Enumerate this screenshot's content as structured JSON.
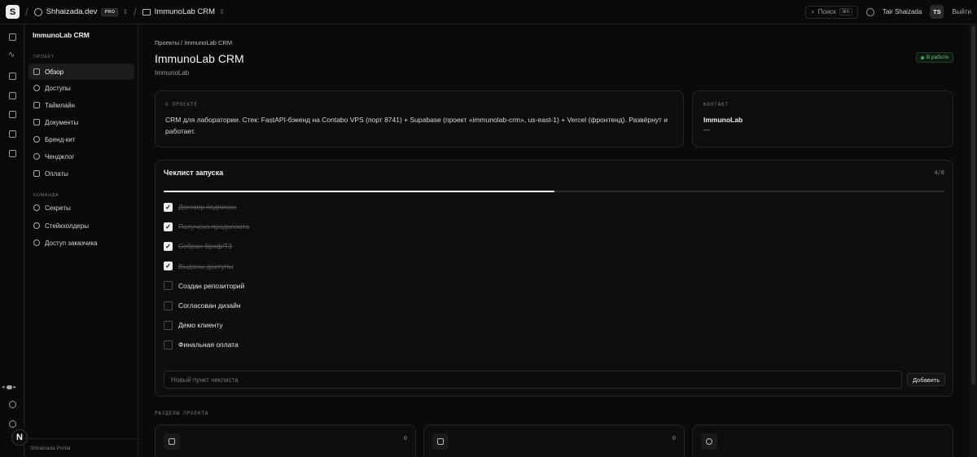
{
  "topbar": {
    "workspace": "Shhaizada.dev",
    "plan": "PRO",
    "project": "ImmunoLab CRM",
    "search_label": "Поиск",
    "search_kbd": "⌘K",
    "user_name": "Tair Shaizada",
    "user_initials": "TS",
    "logout": "Выйти"
  },
  "sidebar": {
    "title": "ImmunoLab CRM",
    "group_project": "Проект",
    "project_items": [
      {
        "label": "Обзор",
        "icon": "layout-icon",
        "active": true
      },
      {
        "label": "Доступы",
        "icon": "key-icon"
      },
      {
        "label": "Таймлайн",
        "icon": "calendar-icon"
      },
      {
        "label": "Документы",
        "icon": "file-icon"
      },
      {
        "label": "Бренд-кит",
        "icon": "palette-icon"
      },
      {
        "label": "Ченджлог",
        "icon": "history-icon"
      },
      {
        "label": "Оплаты",
        "icon": "card-icon"
      }
    ],
    "group_team": "Команда",
    "team_items": [
      {
        "label": "Секреты",
        "icon": "key-icon"
      },
      {
        "label": "Стейкхолдеры",
        "icon": "user-icon"
      },
      {
        "label": "Доступ заказчика",
        "icon": "eye-icon"
      }
    ],
    "footer": "Shhaizada Portal"
  },
  "main": {
    "breadcrumb": "Проекты / ImmunoLab CRM",
    "title": "ImmunoLab CRM",
    "subtitle": "ImmunoLab",
    "status": "В работе",
    "about": {
      "label": "О проекте",
      "text": "CRM для лаборатории. Стек: FastAPI-бэкенд на Contabo VPS (порт 8741) + Supabase (проект «immunolab-crm», us-east-1) + Vercel (фронтенд). Развёрнут и работает."
    },
    "contact": {
      "label": "Контакт",
      "name": "ImmunoLab",
      "value": "—"
    },
    "checklist": {
      "title": "Чеклист запуска",
      "count": "4/8",
      "progress": 0.5,
      "items": [
        {
          "label": "Договор подписан",
          "done": true
        },
        {
          "label": "Получена предоплата",
          "done": true
        },
        {
          "label": "Собран бриф/ТЗ",
          "done": true
        },
        {
          "label": "Выданы доступы",
          "done": true
        },
        {
          "label": "Создан репозиторий",
          "done": false
        },
        {
          "label": "Согласован дизайн",
          "done": false
        },
        {
          "label": "Демо клиенту",
          "done": false
        },
        {
          "label": "Финальная оплата",
          "done": false
        }
      ],
      "new_placeholder": "Новый пункт чеклиста",
      "add_label": "Добавить"
    },
    "sections_label": "Разделы проекта",
    "section_cards": [
      {
        "icon": "calendar-icon",
        "count": "0"
      },
      {
        "icon": "file-icon",
        "count": "0"
      },
      {
        "icon": "palette-icon",
        "count": ""
      }
    ]
  },
  "colors": {
    "background": "#0a0a0a",
    "card": "#0e0e0e",
    "status_green": "#4ca65a"
  }
}
